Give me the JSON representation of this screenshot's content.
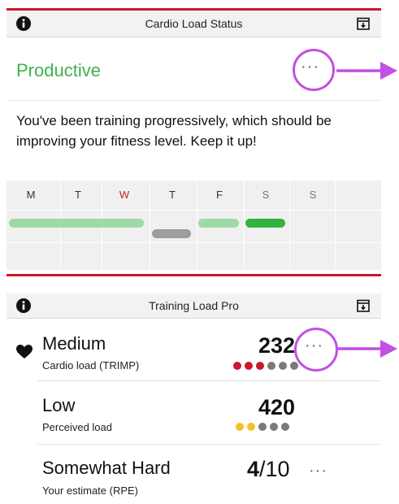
{
  "cardio_status": {
    "title": "Cardio Load Status",
    "status": "Productive",
    "description": "You've been training progressively, which should be improving your fitness level. Keep it up!",
    "more": "···"
  },
  "week": {
    "days": [
      "M",
      "T",
      "W",
      "T",
      "F",
      "S",
      "S"
    ],
    "highlight_color": "#c9182b",
    "bar_colors": {
      "light_green": "#9fd9a6",
      "gray": "#9d9d9d",
      "green": "#31b33f"
    }
  },
  "training_load": {
    "title": "Training Load Pro",
    "rows": [
      {
        "level": "Medium",
        "label": "Cardio load (TRIMP)",
        "value": "232",
        "dots_filled": 3,
        "dots_total": 6,
        "dot_color": "#c9182b"
      },
      {
        "level": "Low",
        "label": "Perceived load",
        "value": "420",
        "dots_filled": 2,
        "dots_total": 5,
        "dot_color": "#f2c12e"
      },
      {
        "level": "Somewhat Hard",
        "label": "Your estimate (RPE)",
        "value_main": "4",
        "value_suffix": "/10",
        "more": "···"
      }
    ],
    "more": "···"
  },
  "colors": {
    "accent_red": "#c9182b",
    "status_green": "#3fb24d",
    "annotation_purple": "#c34fe3",
    "dot_gray": "#7a7a7a"
  }
}
